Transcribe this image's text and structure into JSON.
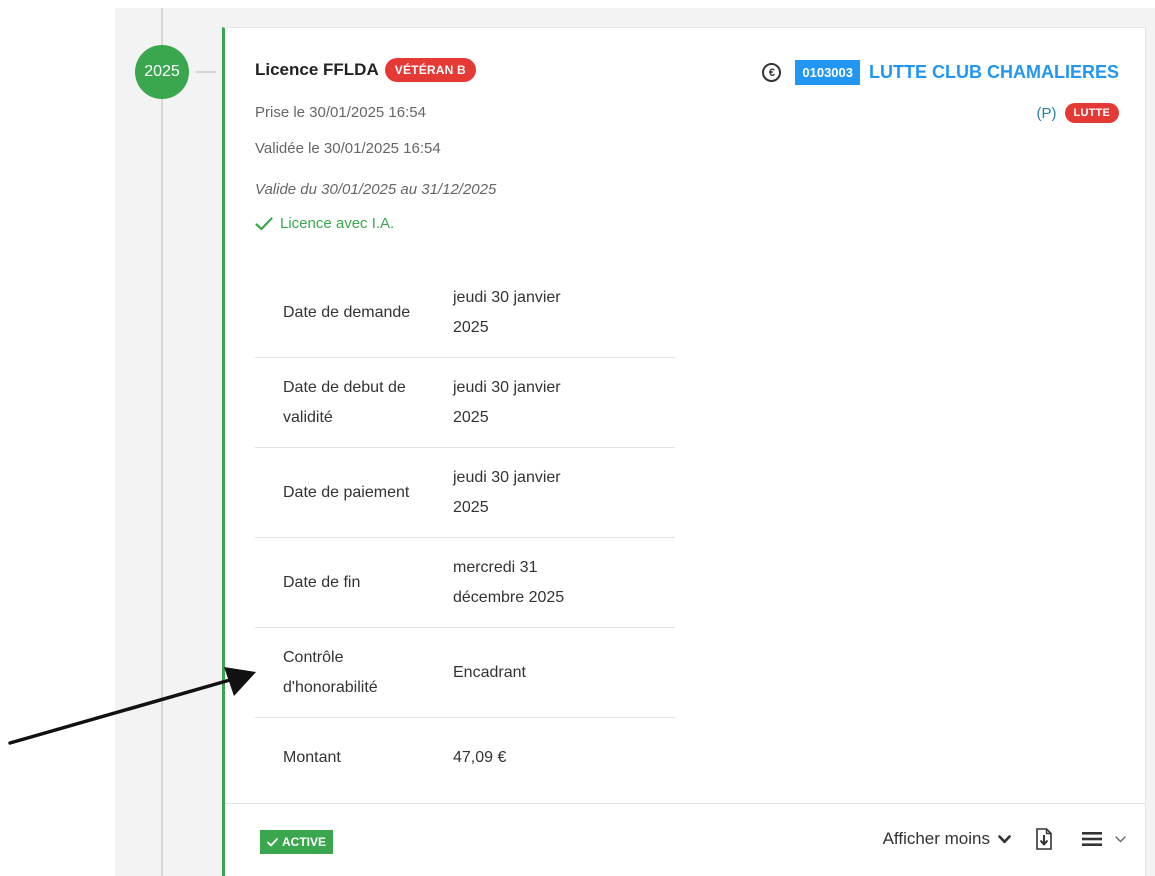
{
  "timeline": {
    "year": "2025"
  },
  "license": {
    "title": "Licence FFLDA",
    "category_badge": "VÉTÉRAN B",
    "taken": "Prise le 30/01/2025 16:54",
    "validated": "Validée le 30/01/2025 16:54",
    "validity": "Valide du 30/01/2025 au 31/12/2025",
    "ia_status": "Licence avec I.A."
  },
  "club": {
    "currency_symbol": "€",
    "code": "0103003",
    "name": "LUTTE CLUB CHAMALIERES",
    "role": "(P)",
    "discipline_badge": "LUTTE"
  },
  "details": [
    {
      "label_lines": [
        "Date de demande"
      ],
      "value_lines": [
        "jeudi 30 janvier",
        "2025"
      ]
    },
    {
      "label_lines": [
        "Date de debut de",
        "validité"
      ],
      "value_lines": [
        "jeudi 30 janvier",
        "2025"
      ]
    },
    {
      "label_lines": [
        "Date de paiement"
      ],
      "value_lines": [
        "jeudi 30 janvier",
        "2025"
      ]
    },
    {
      "label_lines": [
        "Date de fin"
      ],
      "value_lines": [
        "mercredi 31",
        "décembre 2025"
      ]
    },
    {
      "label_lines": [
        "Contrôle",
        "d'honorabilité"
      ],
      "value_lines": [
        "Encadrant"
      ]
    },
    {
      "label_lines": [
        "Montant"
      ],
      "value_lines": [
        "47,09 €"
      ]
    }
  ],
  "footer": {
    "status_badge": "ACTIVE",
    "show_less_label": "Afficher moins"
  },
  "colors": {
    "accent_green": "#3aa74f",
    "badge_red": "#e53935",
    "club_blue": "#2196f3"
  },
  "icons": {
    "ia_check": "check-icon",
    "currency": "euro-icon",
    "show_less": "chevron-down-icon",
    "download": "download-icon",
    "menu": "hamburger-menu-icon",
    "menu_caret": "chevron-down-icon",
    "annotation": "arrow-icon"
  }
}
